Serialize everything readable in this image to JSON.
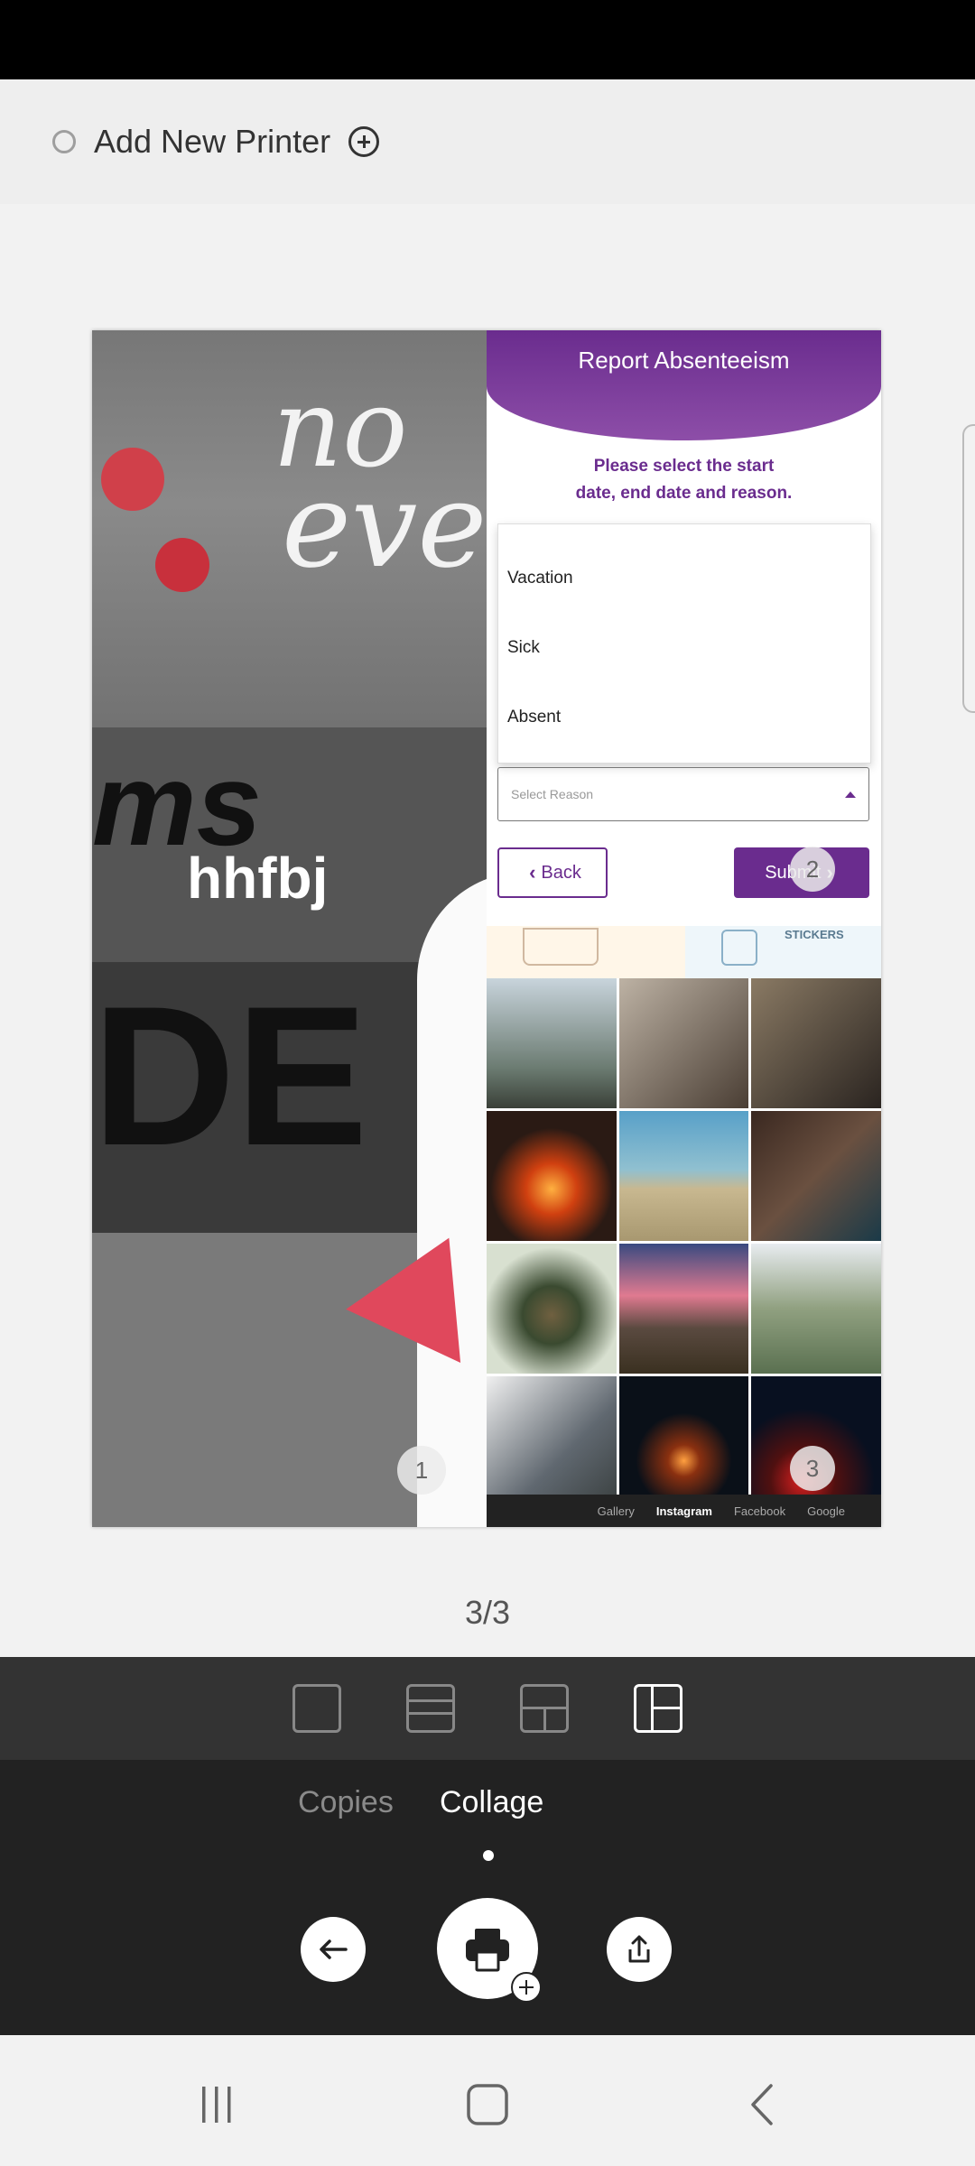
{
  "printer": {
    "label": "Add New Printer"
  },
  "preview": {
    "left": {
      "caption": "hhfbj",
      "texts": [
        "no",
        "eve",
        "ms",
        "DE"
      ],
      "badge": "1"
    },
    "right": {
      "title": "Report Absenteeism",
      "instruction_line1": "Please select the start",
      "instruction_line2": "date, end date and reason.",
      "dropdown_options": [
        "Vacation",
        "Sick",
        "Absent"
      ],
      "select_placeholder": "Select Reason",
      "back_label": "Back",
      "submit_label": "Submit",
      "submit_badge": "2",
      "sticker_label": "STICKERS",
      "grid_badge": "3",
      "photo_tabs": [
        "Gallery",
        "Instagram",
        "Facebook",
        "Google"
      ],
      "active_photo_tab": "Instagram"
    }
  },
  "page_counter": "3/3",
  "layouts": [
    "single",
    "two-rows",
    "grid-three",
    "collage"
  ],
  "active_layout": "collage",
  "modes": {
    "copies": "Copies",
    "collage": "Collage"
  },
  "active_mode": "Collage",
  "colors": {
    "accent": "#6a2c8e",
    "dark_bar": "#222222",
    "layout_bar": "#333333"
  },
  "icons": {
    "back": "arrow-left-icon",
    "print": "printer-icon",
    "share": "share-icon",
    "nav_recent": "recent-apps-icon",
    "nav_home": "home-icon",
    "nav_back": "back-chevron-icon"
  }
}
